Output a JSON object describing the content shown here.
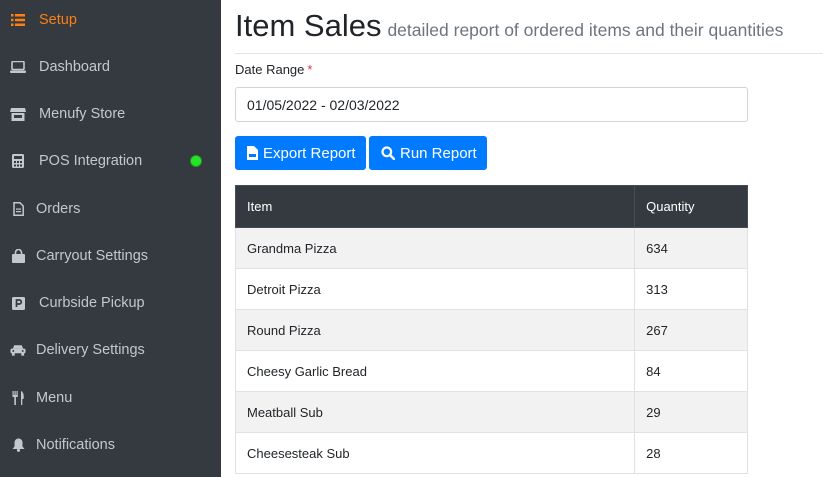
{
  "sidebar": {
    "items": [
      {
        "label": "Setup",
        "icon": "list-icon",
        "active": true
      },
      {
        "label": "Dashboard",
        "icon": "laptop-icon"
      },
      {
        "label": "Menufy Store",
        "icon": "store-icon"
      },
      {
        "label": "POS Integration",
        "icon": "calculator-icon",
        "status": "connected"
      },
      {
        "label": "Orders",
        "icon": "file-icon"
      },
      {
        "label": "Carryout Settings",
        "icon": "shopping-bag-icon"
      },
      {
        "label": "Curbside Pickup",
        "icon": "parking-icon"
      },
      {
        "label": "Delivery Settings",
        "icon": "car-icon"
      },
      {
        "label": "Menu",
        "icon": "utensils-icon"
      },
      {
        "label": "Notifications",
        "icon": "bell-icon"
      }
    ]
  },
  "colors": {
    "sidebar_bg": "#343a40",
    "active": "#fd7e14",
    "primary": "#007bff",
    "status_ok": "#28e428"
  },
  "page": {
    "title": "Item Sales",
    "subtitle": "detailed report of ordered items and their quantities"
  },
  "form": {
    "date_range_label": "Date Range",
    "required_mark": "*",
    "date_range_value": "01/05/2022 - 02/03/2022"
  },
  "buttons": {
    "export": "Export Report",
    "run": "Run Report"
  },
  "table": {
    "headers": [
      "Item",
      "Quantity"
    ],
    "rows": [
      [
        "Grandma Pizza",
        "634"
      ],
      [
        "Detroit Pizza",
        "313"
      ],
      [
        "Round Pizza",
        "267"
      ],
      [
        "Cheesy Garlic Bread",
        "84"
      ],
      [
        "Meatball Sub",
        "29"
      ],
      [
        "Cheesesteak Sub",
        "28"
      ]
    ]
  }
}
